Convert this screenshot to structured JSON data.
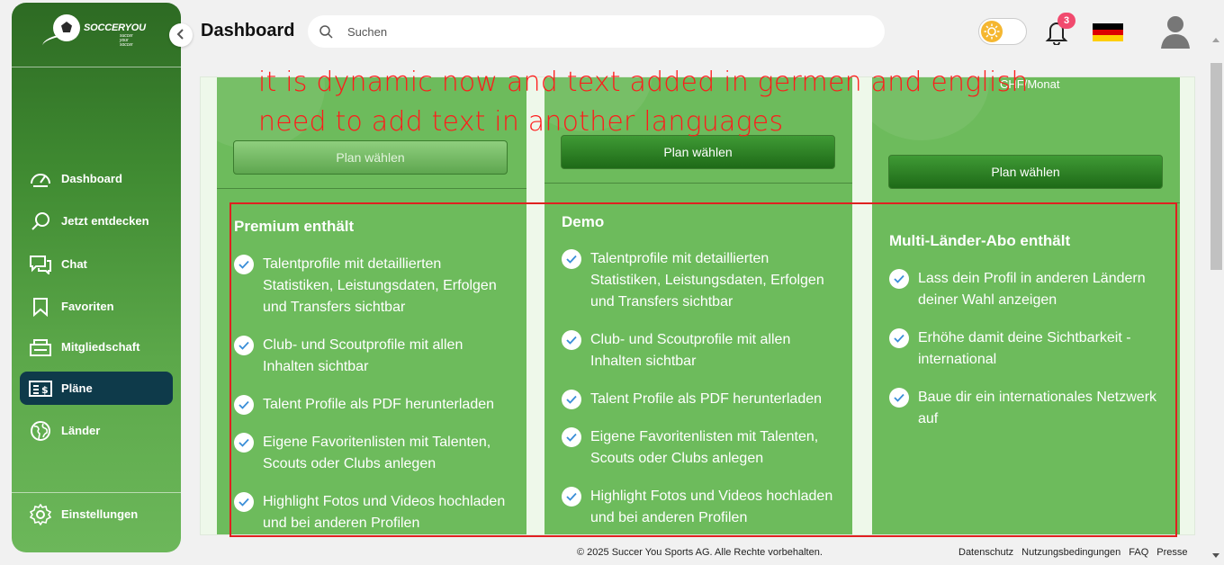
{
  "app": {
    "brand": "SOCCERYOU",
    "tagline": "succer your soccer"
  },
  "sidebar": {
    "items": [
      {
        "label": "Dashboard",
        "icon": "gauge-icon"
      },
      {
        "label": "Jetzt entdecken",
        "icon": "search-icon"
      },
      {
        "label": "Chat",
        "icon": "chat-icon"
      },
      {
        "label": "Favoriten",
        "icon": "bookmark-icon"
      },
      {
        "label": "Mitgliedschaft",
        "icon": "membership-icon"
      },
      {
        "label": "Pläne",
        "icon": "plans-icon",
        "active": true
      },
      {
        "label": "Länder",
        "icon": "globe-icon"
      }
    ],
    "settings_label": "Einstellungen"
  },
  "header": {
    "title": "Dashboard",
    "search_placeholder": "Suchen",
    "notification_count": "3",
    "language": "de",
    "flag_colors": [
      "#000000",
      "#dd0000",
      "#ffce00"
    ]
  },
  "plans": [
    {
      "button": "Plan wählen",
      "heading": "Premium enthält",
      "features": [
        "Talentprofile mit detaillierten Statistiken, Leistungsdaten, Erfolgen und Transfers sichtbar",
        "Club- und Scoutprofile mit allen Inhalten sichtbar",
        "Talent Profile als PDF herunterladen",
        "Eigene Favoritenlisten mit Talenten, Scouts oder Clubs anlegen",
        "Highlight Fotos und Videos hochladen und bei anderen Profilen"
      ]
    },
    {
      "button": "Plan wählen",
      "heading": "Demo",
      "features": [
        "Talentprofile mit detaillierten Statistiken, Leistungsdaten, Erfolgen und Transfers sichtbar",
        "Club- und Scoutprofile mit allen Inhalten sichtbar",
        "Talent Profile als PDF herunterladen",
        "Eigene Favoritenlisten mit Talenten, Scouts oder Clubs anlegen",
        "Highlight Fotos und Videos hochladen und bei anderen Profilen"
      ]
    },
    {
      "price_suffix": "CHF/Monat",
      "button": "Plan wählen",
      "heading": "Multi-Länder-Abo enthält",
      "features": [
        "Lass dein Profil in anderen Ländern deiner Wahl anzeigen",
        "Erhöhe damit deine Sichtbarkeit - international",
        "Baue dir ein internationales Netzwerk auf"
      ]
    }
  ],
  "annotation": {
    "line1": "it is dynamic now and text added in germen and english",
    "line2": "need to add text in another languages"
  },
  "footer": {
    "copyright": "© 2025 Succer You Sports AG. Alle Rechte vorbehalten.",
    "links": [
      "Datenschutz",
      "Nutzungsbedingungen",
      "FAQ",
      "Presse"
    ]
  },
  "colors": {
    "accent": "#6dbb5c",
    "sidebar_active": "#0e3a4a",
    "annotation": "#ff1a1a"
  }
}
